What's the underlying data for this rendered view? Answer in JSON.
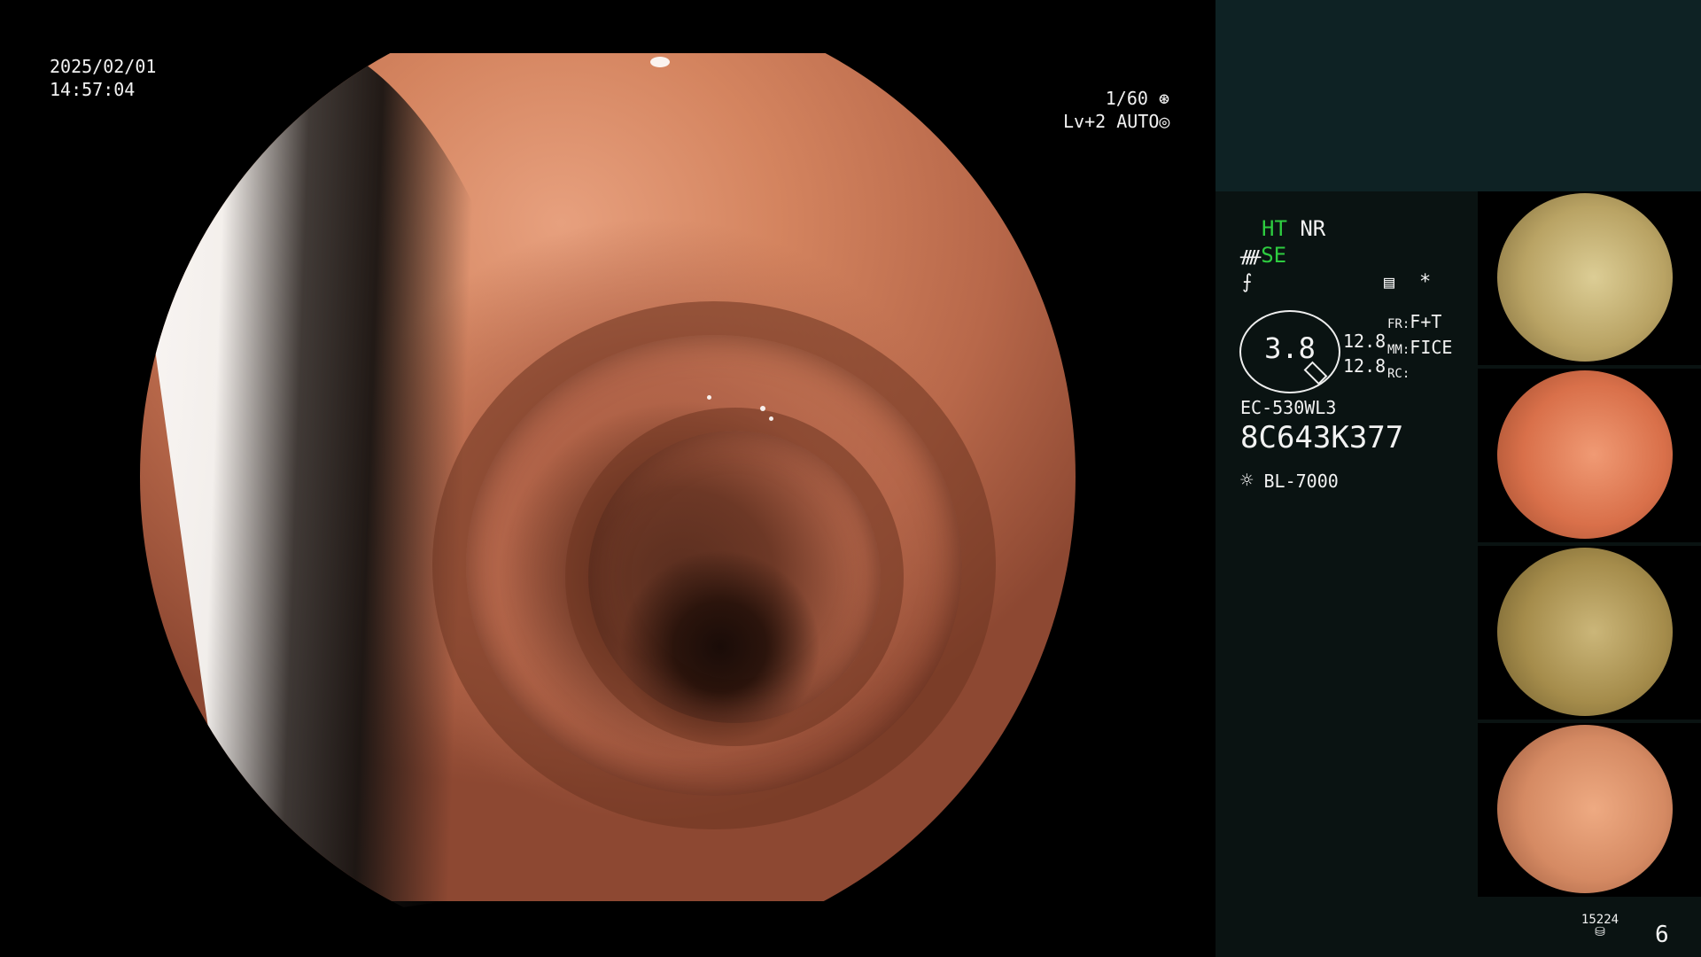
{
  "overlay": {
    "date": "2025/02/01",
    "time": "14:57:04",
    "shutter": "1/60",
    "level": "Lv+2",
    "mode": "AUTO"
  },
  "panel": {
    "ht": "HT",
    "nr": "NR",
    "se": "SE",
    "value_oval": "3.8",
    "val_a": "12.8",
    "val_b": "12.8",
    "fr_label": "FR:",
    "fr_value": "F+T",
    "mm_label": "MM:",
    "mm_value": "FICE",
    "rc_label": "RC:",
    "scope_model": "EC-530WL3",
    "serial": "8C643K377",
    "light_source": "BL-7000",
    "counter": "15224",
    "page": "6"
  },
  "icons": {
    "shutter": "aperture-icon",
    "mode": "iris-icon",
    "scope": "scope-icon",
    "freeze": "freeze-icon",
    "settings": "menu-icon",
    "star": "asterisk-icon",
    "light": "sun-icon",
    "storage": "disk-icon"
  },
  "thumbnails": [
    {
      "tint": "#c6b27a"
    },
    {
      "tint": "#d9704a"
    },
    {
      "tint": "#b39a55"
    },
    {
      "tint": "#d58a63"
    }
  ]
}
